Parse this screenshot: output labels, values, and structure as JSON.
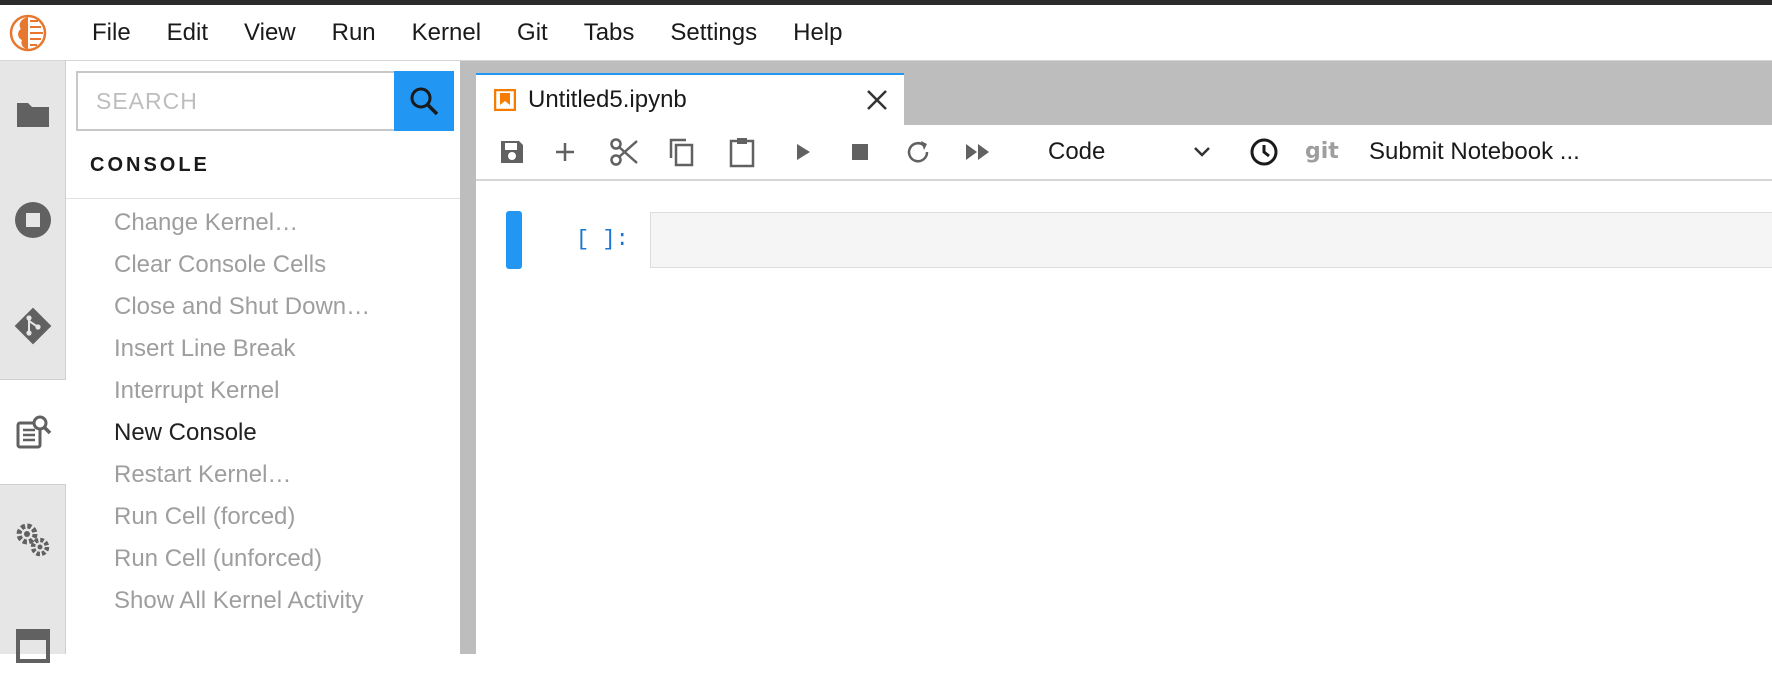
{
  "menubar": {
    "items": [
      "File",
      "Edit",
      "View",
      "Run",
      "Kernel",
      "Git",
      "Tabs",
      "Settings",
      "Help"
    ]
  },
  "activitybar": {
    "items": [
      "folder-icon",
      "running-icon",
      "git-icon",
      "command-palette-icon",
      "property-inspector-icon",
      "tabs-icon"
    ],
    "active": "command-palette-icon"
  },
  "palette": {
    "search_placeholder": "SEARCH",
    "section_title": "CONSOLE",
    "commands": [
      {
        "label": "Change Kernel…",
        "enabled": false
      },
      {
        "label": "Clear Console Cells",
        "enabled": false
      },
      {
        "label": "Close and Shut Down…",
        "enabled": false
      },
      {
        "label": "Insert Line Break",
        "enabled": false
      },
      {
        "label": "Interrupt Kernel",
        "enabled": false
      },
      {
        "label": "New Console",
        "enabled": true
      },
      {
        "label": "Restart Kernel…",
        "enabled": false
      },
      {
        "label": "Run Cell (forced)",
        "enabled": false
      },
      {
        "label": "Run Cell (unforced)",
        "enabled": false
      },
      {
        "label": "Show All Kernel Activity",
        "enabled": false
      }
    ]
  },
  "tab": {
    "title": "Untitled5.ipynb"
  },
  "toolbar": {
    "cell_type": "Code",
    "git_label": "git",
    "submit_label": "Submit Notebook ..."
  },
  "cell": {
    "prompt": "[ ]:"
  },
  "colors": {
    "accent": "#2196f3",
    "notebook_icon": "#f57c00",
    "disabled_text": "#9e9e9e"
  }
}
